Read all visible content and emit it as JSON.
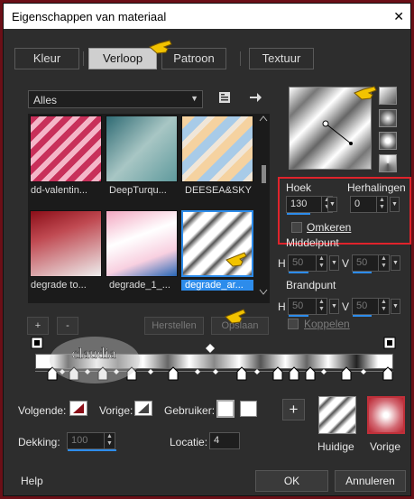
{
  "window": {
    "title": "Eigenschappen van materiaal",
    "close_glyph": "✕"
  },
  "tabs": [
    {
      "label": "Kleur",
      "active": false
    },
    {
      "label": "Verloop",
      "active": true
    },
    {
      "label": "Patroon",
      "active": false
    },
    {
      "label": "Textuur",
      "active": false
    }
  ],
  "library": {
    "category": "Alles",
    "items": [
      {
        "label": "dd-valentin...",
        "colors": "#c8305a,#f4b6c8"
      },
      {
        "label": "DeepTurqu...",
        "colors": "#3f7e85,#a8c6c4"
      },
      {
        "label": "DEESEA&SKY",
        "colors": "#f5d2a0,#a8cbe8"
      },
      {
        "label": "degrade to...",
        "colors": "#a4131e,#eeeeee"
      },
      {
        "label": "degrade_1_...",
        "colors": "#f7c4d6,#2766b5"
      },
      {
        "label": "degrade_ar...",
        "colors": "#ffffff,#555555",
        "selected": true
      }
    ],
    "buttons": {
      "add": "+",
      "remove": "-",
      "restore": "Herstellen",
      "save": "Opslaan"
    }
  },
  "settings": {
    "hoek_label": "Hoek",
    "hoek_value": "130",
    "herhalingen_label": "Herhalingen",
    "herhalingen_value": "0",
    "omkeren_label": "Omkeren",
    "middelpunt_label": "Middelpunt",
    "middelpunt_h_label": "H",
    "middelpunt_h": "50",
    "middelpunt_v_label": "V",
    "middelpunt_v": "50",
    "brandpunt_label": "Brandpunt",
    "brandpunt_h_label": "H",
    "brandpunt_h": "50",
    "brandpunt_v_label": "V",
    "brandpunt_v": "50",
    "koppelen_label": "Koppelen"
  },
  "watermark": "claudia",
  "stop_panel": {
    "volgende_label": "Volgende:",
    "vorige_label": "Vorige:",
    "gebruiker_label": "Gebruiker:",
    "dekking_label": "Dekking:",
    "dekking_value": "100",
    "locatie_label": "Locatie:",
    "locatie_value": "4"
  },
  "current": {
    "plus": "+",
    "huidige_label": "Huidige",
    "vorige_label": "Vorige"
  },
  "footer": {
    "help": "Help",
    "ok": "OK",
    "cancel": "Annuleren"
  },
  "colors": {
    "accent": "#2d8ceb",
    "highlight_box": "#e0232b",
    "background": "#2d2d2d",
    "frame": "#6b0f17",
    "previous_swatch": "#c0303a"
  }
}
